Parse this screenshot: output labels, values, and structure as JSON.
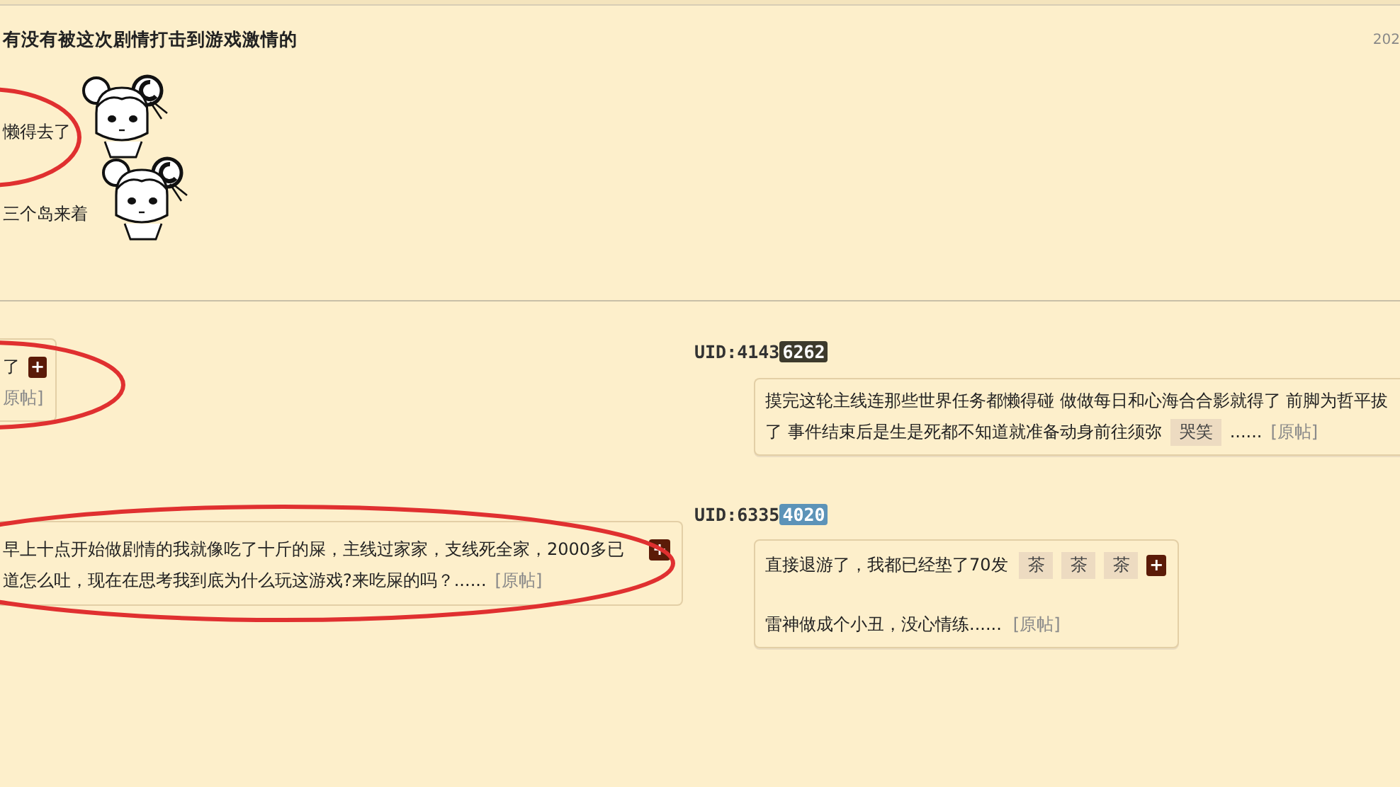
{
  "thread": {
    "title": "有没有被这次剧情打击到游戏激情的",
    "date": "202",
    "lines": [
      {
        "text": "懒得去了",
        "sticker": true
      },
      {
        "text": "三个岛来着",
        "sticker": true
      }
    ]
  },
  "left_replies": [
    {
      "lines": [
        [
          {
            "kind": "text",
            "text": "了"
          },
          {
            "kind": "plus",
            "text": "+"
          }
        ],
        [
          {
            "kind": "link",
            "text": "原帖]"
          }
        ]
      ]
    },
    {
      "lines": [
        [
          {
            "kind": "text",
            "text": "早上十点开始做剧情的我就像吃了十斤的屎，主线过家家，支线死全家，2000多已"
          },
          {
            "kind": "plus",
            "text": "+"
          }
        ],
        [
          {
            "kind": "text",
            "text": "道怎么吐，现在在思考我到底为什么玩这游戏?来吃屎的吗？......"
          },
          {
            "kind": "link",
            "text": "[原帖]"
          }
        ]
      ]
    }
  ],
  "right_replies": [
    {
      "uid": "UID:4143",
      "uid_badge": "6262",
      "color": "#3d3a2c",
      "lines": [
        [
          {
            "kind": "text",
            "text": "摸完这轮主线连那些世界任务都懒得碰 做做每日和心海合合影就得了 前脚为哲平拔"
          }
        ],
        [
          {
            "kind": "text",
            "text": "了 事件结束后是生是死都不知道就准备动身前往须弥"
          },
          {
            "kind": "emote",
            "text": "哭笑"
          },
          {
            "kind": "text",
            "text": "......"
          },
          {
            "kind": "link",
            "text": "[原帖]"
          }
        ]
      ]
    },
    {
      "uid": "UID:6335",
      "uid_badge": "4020",
      "color": "#5c93b8",
      "lines": [
        [
          {
            "kind": "text",
            "text": "直接退游了，我都已经垫了70发"
          },
          {
            "kind": "emote",
            "text": "茶"
          },
          {
            "kind": "emote",
            "text": "茶"
          },
          {
            "kind": "emote",
            "text": "茶"
          },
          {
            "kind": "plus",
            "text": "+"
          }
        ],
        [
          {
            "kind": "text",
            "text": "雷神做成个小丑，没心情练......"
          },
          {
            "kind": "link",
            "text": "[原帖]"
          }
        ]
      ]
    }
  ]
}
